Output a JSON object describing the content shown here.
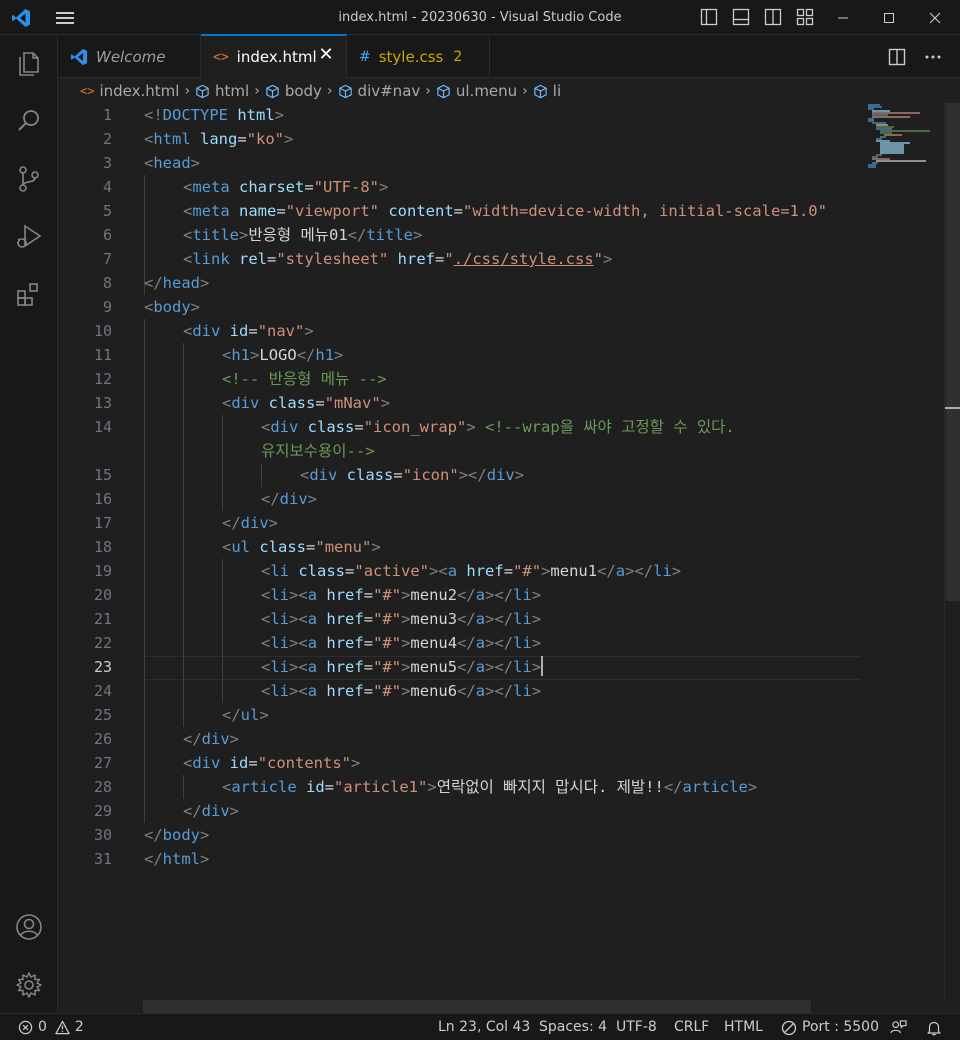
{
  "window": {
    "title": "index.html - 20230630 - Visual Studio Code",
    "minimize_glyph": "—",
    "maximize_glyph": "□",
    "close_glyph": "✕"
  },
  "tabs": [
    {
      "label": "Welcome",
      "icon": "vscode-logo-icon"
    },
    {
      "label": "index.html",
      "icon": "html-file-icon",
      "close": "✕"
    },
    {
      "label": "style.css",
      "icon": "css-file-icon",
      "badge": "2",
      "icon_glyph": "#"
    }
  ],
  "breadcrumb": [
    "index.html",
    "html",
    "body",
    "div#nav",
    "ul.menu",
    "li"
  ],
  "line_numbers": [
    "1",
    "2",
    "3",
    "4",
    "5",
    "6",
    "7",
    "8",
    "9",
    "10",
    "11",
    "12",
    "13",
    "14",
    "",
    "15",
    "16",
    "17",
    "18",
    "19",
    "20",
    "21",
    "22",
    "23",
    "24",
    "25",
    "26",
    "27",
    "28",
    "29",
    "30",
    "31"
  ],
  "code": {
    "l1": {
      "open": "<!",
      "doctype": "DOCTYPE",
      "name": " html",
      "close": ">"
    },
    "l2": {
      "lt": "<",
      "tag": "html",
      "attr": " lang",
      "eq": "=",
      "val": "\"ko\"",
      "gt": ">"
    },
    "l3": {
      "lt": "<",
      "tag": "head",
      "gt": ">"
    },
    "l4": {
      "lt": "<",
      "tag": "meta",
      "attr": " charset",
      "eq": "=",
      "val": "\"UTF-8\"",
      "gt": ">"
    },
    "l5": {
      "lt": "<",
      "tag": "meta",
      "attr1": " name",
      "eq1": "=",
      "val1": "\"viewport\"",
      "attr2": " content",
      "eq2": "=",
      "val2": "\"width=device-width, initial-scale=1.0\""
    },
    "l6": {
      "lt": "<",
      "tag": "title",
      "gt": ">",
      "text": "반응형 메뉴01",
      "end_lt": "</",
      "end_tag": "title",
      "end_gt": ">"
    },
    "l7": {
      "lt": "<",
      "tag": "link",
      "attr1": " rel",
      "eq1": "=",
      "val1": "\"stylesheet\"",
      "attr2": " href",
      "eq2": "=",
      "q1": "\"",
      "link": "./css/style.css",
      "q2": "\"",
      "gt": ">"
    },
    "l8": {
      "lt": "</",
      "tag": "head",
      "gt": ">"
    },
    "l9": {
      "lt": "<",
      "tag": "body",
      "gt": ">"
    },
    "l10": {
      "lt": "<",
      "tag": "div",
      "attr": " id",
      "eq": "=",
      "val": "\"nav\"",
      "gt": ">"
    },
    "l11": {
      "lt": "<",
      "tag": "h1",
      "gt": ">",
      "text": "LOGO",
      "end_lt": "</",
      "end_tag": "h1",
      "end_gt": ">"
    },
    "l12": {
      "comment": "<!-- 반응형 메뉴 -->"
    },
    "l13": {
      "lt": "<",
      "tag": "div",
      "attr": " class",
      "eq": "=",
      "val": "\"mNav\"",
      "gt": ">"
    },
    "l14": {
      "lt": "<",
      "tag": "div",
      "attr": " class",
      "eq": "=",
      "val": "\"icon_wrap\"",
      "gt": ">",
      "comment": " <!--wrap을 싸야 고정할 수 있다."
    },
    "l14b": {
      "comment": "유지보수용이-->"
    },
    "l15": {
      "lt": "<",
      "tag": "div",
      "attr": " class",
      "eq": "=",
      "val": "\"icon\"",
      "gt": ">",
      "end_lt": "</",
      "end_tag": "div",
      "end_gt": ">"
    },
    "l16": {
      "lt": "</",
      "tag": "div",
      "gt": ">"
    },
    "l17": {
      "lt": "</",
      "tag": "div",
      "gt": ">"
    },
    "l18": {
      "lt": "<",
      "tag": "ul",
      "attr": " class",
      "eq": "=",
      "val": "\"menu\"",
      "gt": ">"
    },
    "l19": {
      "lt": "<",
      "tag": "li",
      "attr": " class",
      "eq": "=",
      "val": "\"active\"",
      "gt": ">",
      "a_lt": "<",
      "a_tag": "a",
      "a_attr": " href",
      "a_eq": "=",
      "a_val": "\"#\"",
      "a_gt": ">",
      "text": "menu1",
      "ea_lt": "</",
      "ea_tag": "a",
      "ea_gt": ">",
      "el_lt": "</",
      "el_tag": "li",
      "el_gt": ">"
    },
    "menu_items": [
      "menu2",
      "menu3",
      "menu4",
      "menu5",
      "menu6"
    ],
    "li_parts": {
      "lt": "<",
      "li": "li",
      "gt": ">",
      "a": "a",
      "href": " href",
      "eq": "=",
      "val": "\"#\"",
      "end_lt": "</"
    },
    "l25": {
      "lt": "</",
      "tag": "ul",
      "gt": ">"
    },
    "l26": {
      "lt": "</",
      "tag": "div",
      "gt": ">"
    },
    "l27": {
      "lt": "<",
      "tag": "div",
      "attr": " id",
      "eq": "=",
      "val": "\"contents\"",
      "gt": ">"
    },
    "l28": {
      "lt": "<",
      "tag": "article",
      "attr": " id",
      "eq": "=",
      "val": "\"article1\"",
      "gt": ">",
      "text": "연락없이 빠지지 맙시다. 제발!!",
      "end_lt": "</",
      "end_tag": "article",
      "end_gt": ">"
    },
    "l29": {
      "lt": "</",
      "tag": "div",
      "gt": ">"
    },
    "l30": {
      "lt": "</",
      "tag": "body",
      "gt": ">"
    },
    "l31": {
      "lt": "</",
      "tag": "html",
      "gt": ">"
    }
  },
  "status": {
    "errors": "0",
    "warnings": "2",
    "position": "Ln 23, Col 43",
    "spaces": "Spaces: 4",
    "encoding": "UTF-8",
    "eol": "CRLF",
    "language": "HTML",
    "port": "Port : 5500"
  },
  "colors": {
    "accent": "#0078d4",
    "tag": "#569cd6",
    "attribute": "#9cdcfe",
    "string": "#ce9178",
    "comment": "#6a9955",
    "warning_badge": "#cca700",
    "css_icon": "#42a5f5",
    "html_icon": "#e37933"
  }
}
